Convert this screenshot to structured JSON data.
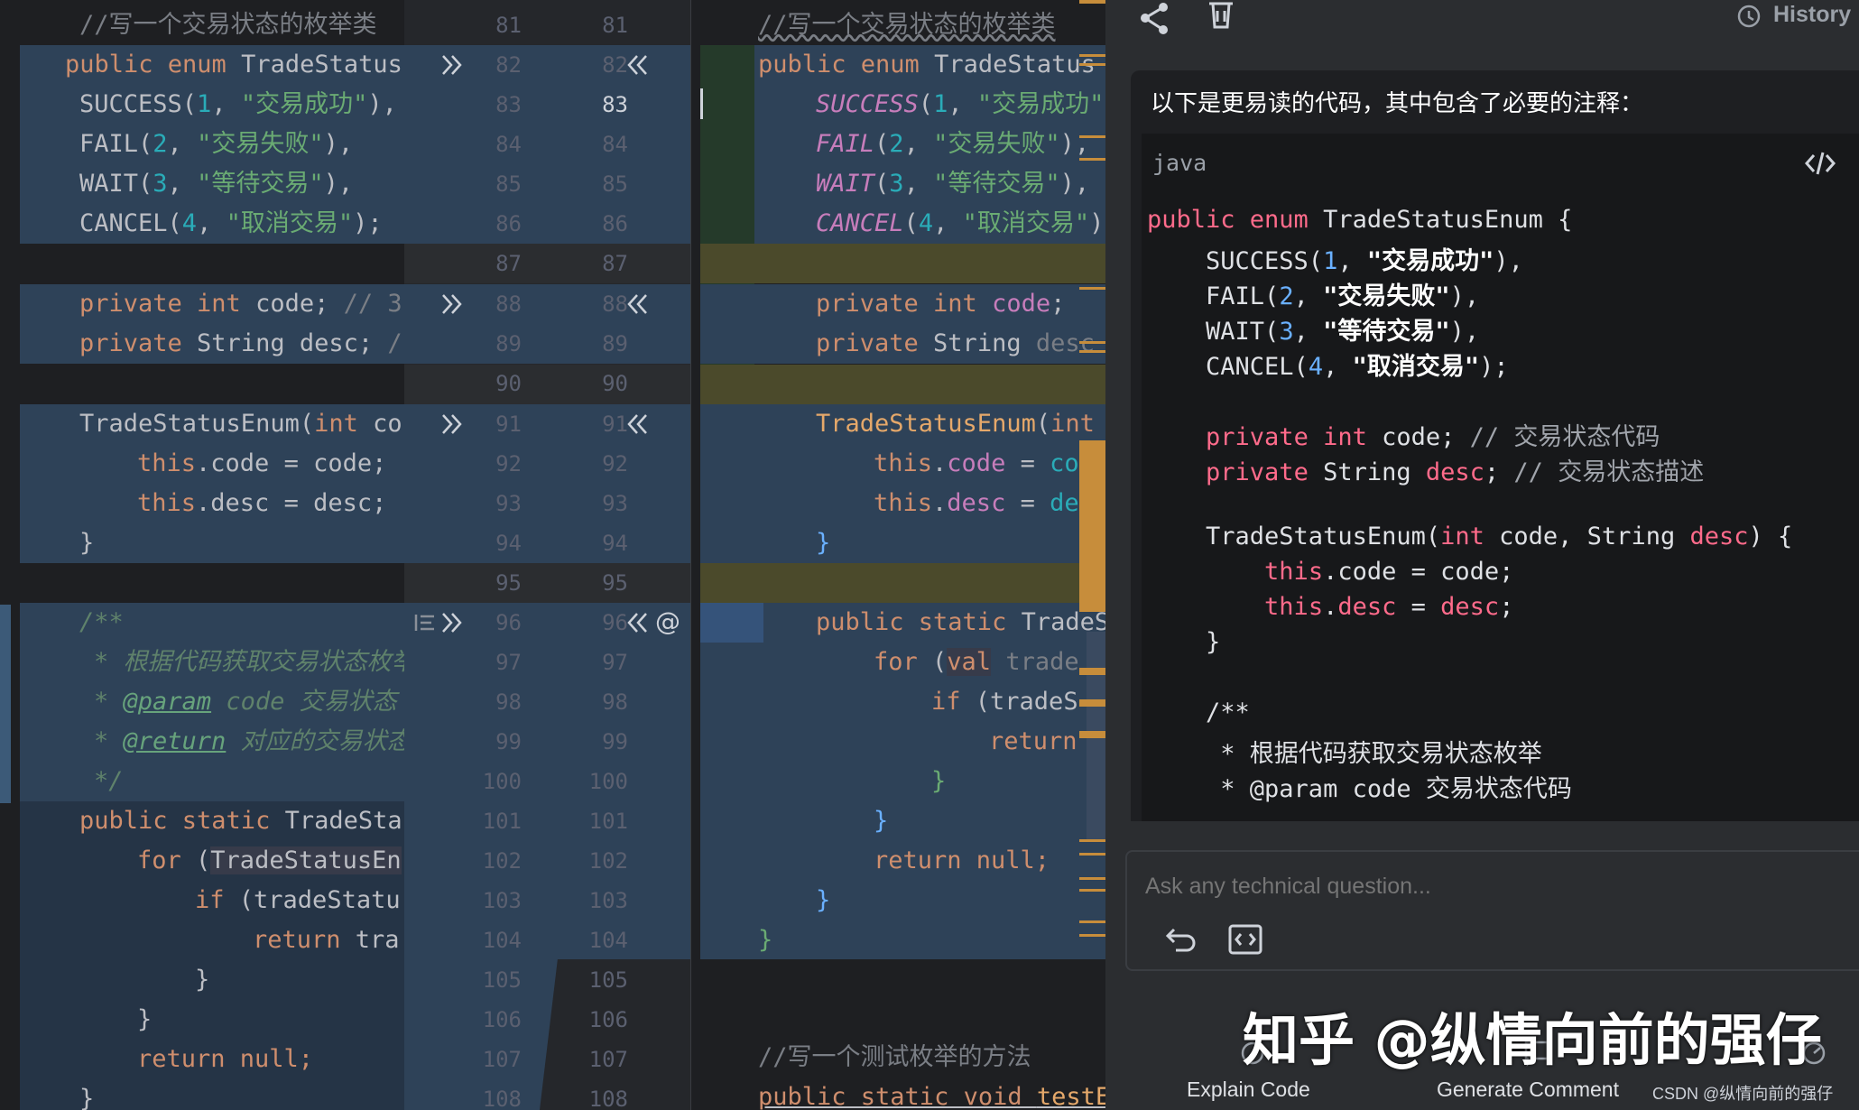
{
  "left_editor": {
    "lines": [
      "//写一个交易状态的枚举类",
      "public enum TradeStatus",
      "SUCCESS(1, \"交易成功\"),",
      "FAIL(2, \"交易失败\"),",
      "WAIT(3, \"等待交易\"),",
      "CANCEL(4, \"取消交易\");",
      "private int code; // 3",
      "private String desc; /",
      "TradeStatusEnum(int co",
      "this.code = code;",
      "this.desc = desc;",
      "}",
      "/**",
      "* 根据代码获取交易状态枚举",
      "* @param code 交易状态",
      "* @return 对应的交易状态",
      "*/",
      "public static TradeSta",
      "for (TradeStatusEn",
      "if (tradeStatu",
      "return tra",
      "}",
      "}",
      "return null;",
      "}"
    ]
  },
  "diff_gutter": {
    "left_numbers": [
      "81",
      "82",
      "83",
      "84",
      "85",
      "86",
      "87",
      "88",
      "89",
      "90",
      "91",
      "92",
      "93",
      "94",
      "95",
      "96",
      "97",
      "98",
      "99",
      "100",
      "101",
      "102",
      "103",
      "104",
      "105",
      "106",
      "107",
      "108"
    ],
    "right_numbers": [
      "81",
      "82",
      "83",
      "84",
      "85",
      "86",
      "87",
      "88",
      "89",
      "90",
      "91",
      "92",
      "93",
      "94",
      "95",
      "96",
      "97",
      "98",
      "99",
      "100",
      "101",
      "102",
      "103",
      "104",
      "105",
      "106",
      "107",
      "108"
    ],
    "current_line": "83"
  },
  "right_editor": {
    "lines": [
      "//写一个交易状态的枚举类",
      "public enum TradeStatus",
      "SUCCESS(1, \"交易成功\")",
      "FAIL(2, \"交易失败\"),",
      "WAIT(3, \"等待交易\"),",
      "CANCEL(4, \"取消交易\");",
      "private int code;",
      "private String desc",
      "TradeStatusEnum(int",
      "this.code = co",
      "this.desc = de",
      "}",
      "public static TradeS",
      "for (val trade",
      "if (tradeS",
      "return",
      "}",
      "}",
      "return null;",
      "}",
      "}",
      "//写一个测试枚举的方法",
      "public static void testE"
    ]
  },
  "ai_panel": {
    "history_label": "History",
    "message": "以下是更易读的代码，其中包含了必要的注释：",
    "code_lang": "java",
    "code_lines": [
      "public enum TradeStatusEnum {",
      "    SUCCESS(1, \"交易成功\"),",
      "    FAIL(2, \"交易失败\"),",
      "    WAIT(3, \"等待交易\"),",
      "    CANCEL(4, \"取消交易\");",
      "",
      "    private int code; // 交易状态代码",
      "    private String desc; // 交易状态描述",
      "",
      "    TradeStatusEnum(int code, String desc) {",
      "        this.code = code;",
      "        this.desc = desc;",
      "    }",
      "",
      "    /**",
      "     * 根据代码获取交易状态枚举",
      "     * @param code 交易状态代码"
    ],
    "input_placeholder": "Ask any technical question...",
    "actions": [
      "Explain Code",
      "Generate Comment"
    ],
    "watermark": "知乎 @纵情向前的强仔",
    "csdn_mark": "CSDN @纵情向前的强仔"
  },
  "colors": {
    "accent_orange": "#c78d3b",
    "highlight_blue": "#2e4258",
    "olive": "#4b4a2b"
  }
}
